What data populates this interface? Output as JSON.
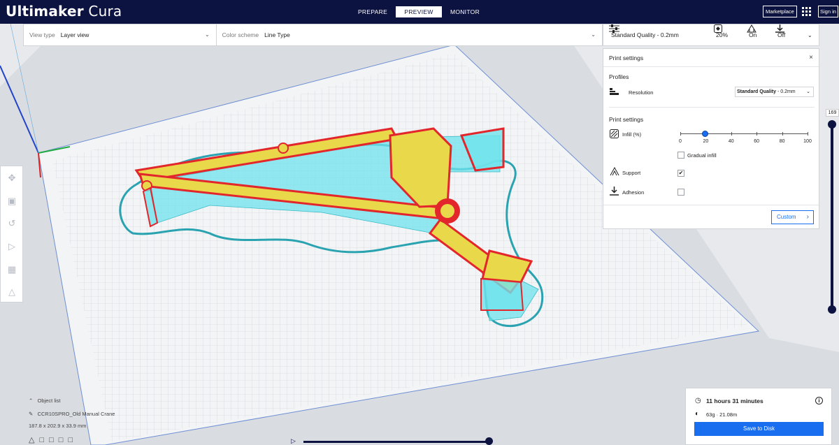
{
  "app": {
    "title_bold": "Ultimaker",
    "title_rest": "Cura"
  },
  "stages": [
    {
      "label": "PREPARE"
    },
    {
      "label": "PREVIEW"
    },
    {
      "label": "MONITOR"
    }
  ],
  "header": {
    "marketplace": "Marketplace",
    "signin": "Sign in"
  },
  "view_options": {
    "view_type_label": "View type",
    "view_type_value": "Layer view",
    "color_scheme_label": "Color scheme",
    "color_scheme_value": "Line Type"
  },
  "print_bar": {
    "profile": "Standard Quality - 0.2mm",
    "infill": "20%",
    "support": "On",
    "adhesion": "Off"
  },
  "print_panel": {
    "title": "Print settings",
    "close": "×",
    "profiles_title": "Profiles",
    "resolution_label": "Resolution",
    "resolution_bold": "Standard Quality",
    "resolution_rest": " - 0.2mm",
    "settings_title": "Print settings",
    "infill_label": "Infill (%)",
    "infill_value": 20,
    "infill_ticks": [
      "0",
      "20",
      "40",
      "60",
      "80",
      "100"
    ],
    "gradual_label": "Gradual infill",
    "gradual_checked": false,
    "support_label": "Support",
    "support_checked": true,
    "adhesion_label": "Adhesion",
    "adhesion_checked": false,
    "custom_button": "Custom"
  },
  "layer_slider": {
    "current_layer": "169"
  },
  "object_list": {
    "header": "Object list",
    "object_name": "CCR10SPRO_Old Manual Crane",
    "dimensions": "187.8 x 202.9 x 33.9 mm"
  },
  "job": {
    "time": "11 hours 31 minutes",
    "material": "63g · 21.08m",
    "save_button": "Save to Disk"
  },
  "colors": {
    "topbar": "#0c1340",
    "accent": "#196ef0",
    "support": "#6fe3ec",
    "wall_outer": "#e2262c",
    "wall_inner": "#e8d84a"
  },
  "icons": {
    "toolbar": [
      "move-icon",
      "scale-icon",
      "rotate-icon",
      "mirror-icon",
      "per-model-settings-icon",
      "support-blocker-icon"
    ]
  }
}
